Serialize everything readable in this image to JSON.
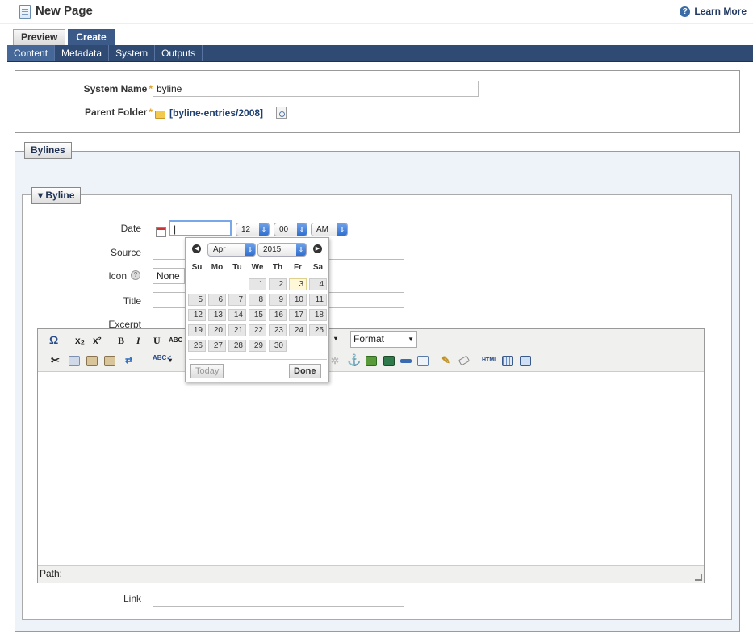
{
  "header": {
    "title": "New Page",
    "learn_more": "Learn More"
  },
  "tabs": [
    {
      "label": "Preview"
    },
    {
      "label": "Create"
    }
  ],
  "subnav": [
    {
      "label": "Content"
    },
    {
      "label": "Metadata"
    },
    {
      "label": "System"
    },
    {
      "label": "Outputs"
    }
  ],
  "properties": {
    "system_name_label": "System Name",
    "system_name_value": "byline",
    "parent_folder_label": "Parent Folder",
    "parent_folder_value": "[byline-entries/2008]",
    "required_mark": "*"
  },
  "bylines_group": {
    "legend": "Bylines",
    "byline_legend": "▾ Byline"
  },
  "form": {
    "date_label": "Date",
    "date_value": "|",
    "hour": "12",
    "minute": "00",
    "ampm": "AM",
    "source_label": "Source",
    "icon_label": "Icon",
    "icon_value": "None",
    "title_label": "Title",
    "excerpt_label": "Excerpt",
    "link_label": "Link"
  },
  "editor": {
    "format_label": "Format",
    "path_label": "Path:",
    "html_label": "HTML"
  },
  "calendar": {
    "month": "Apr",
    "year": "2015",
    "weekdays": [
      "Su",
      "Mo",
      "Tu",
      "We",
      "Th",
      "Fr",
      "Sa"
    ],
    "days": [
      "1",
      "2",
      "3",
      "4",
      "5",
      "6",
      "7",
      "8",
      "9",
      "10",
      "11",
      "12",
      "13",
      "14",
      "15",
      "16",
      "17",
      "18",
      "19",
      "20",
      "21",
      "22",
      "23",
      "24",
      "25",
      "26",
      "27",
      "28",
      "29",
      "30"
    ],
    "today_label": "Today",
    "done_label": "Done"
  }
}
